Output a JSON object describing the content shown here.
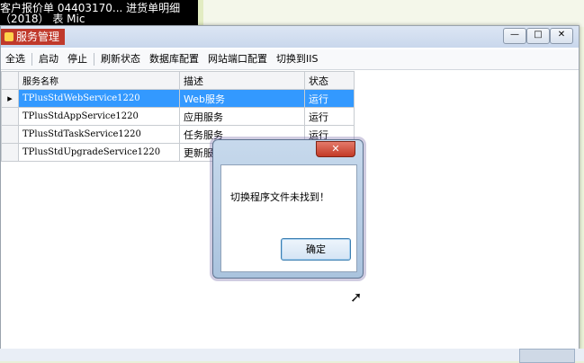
{
  "desktop": {
    "line1": "客户报价单  04403170...   进货单明细",
    "line2": "（2018）                        表          Mic"
  },
  "window": {
    "app_title": "服务管理",
    "controls": {
      "minimize": "—",
      "maximize": "□",
      "close": "✕"
    }
  },
  "toolbar": {
    "select_all": "全选",
    "start": "启动",
    "stop": "停止",
    "refresh": "刷新状态",
    "db_config": "数据库配置",
    "port_config": "网站端口配置",
    "switch_iis": "切换到IIS"
  },
  "grid": {
    "headers": {
      "name": "服务名称",
      "desc": "描述",
      "status": "状态"
    },
    "rows": [
      {
        "name": "TPlusStdWebService1220",
        "desc": "Web服务",
        "status": "运行"
      },
      {
        "name": "TPlusStdAppService1220",
        "desc": "应用服务",
        "status": "运行"
      },
      {
        "name": "TPlusStdTaskService1220",
        "desc": "任务服务",
        "status": "运行"
      },
      {
        "name": "TPlusStdUpgradeService1220",
        "desc": "更新服",
        "status": ""
      }
    ],
    "selected_marker": "▸"
  },
  "dialog": {
    "message": "切换程序文件未找到！",
    "ok_label": "确定",
    "close_label": "✕"
  }
}
